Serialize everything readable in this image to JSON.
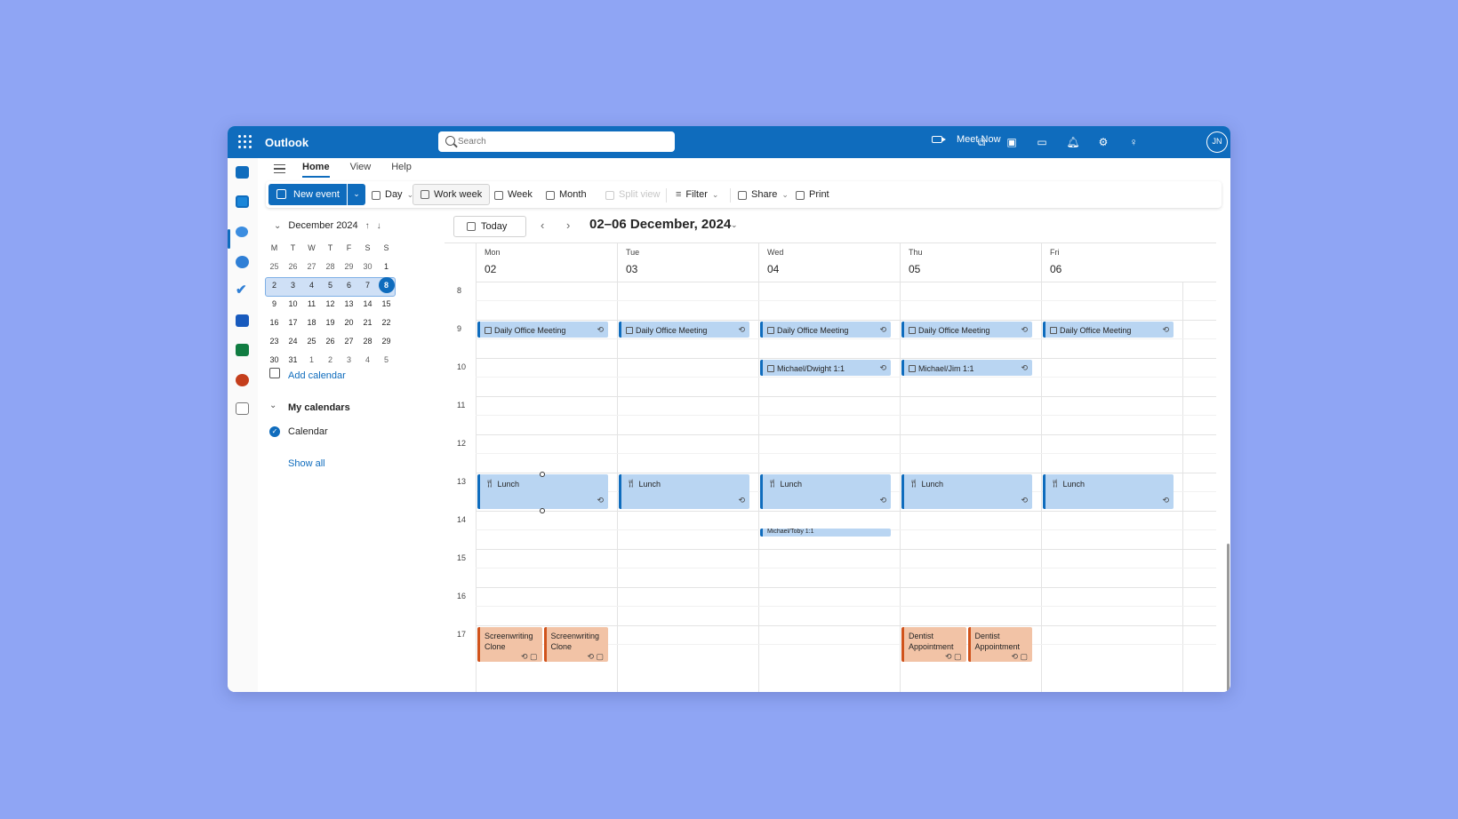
{
  "app": {
    "name": "Outlook"
  },
  "search": {
    "placeholder": "Search"
  },
  "topbar": {
    "meet_now": "Meet Now",
    "avatar": "JN"
  },
  "tabs": [
    "Home",
    "View",
    "Help"
  ],
  "ribbon": {
    "new_event": "New event",
    "day": "Day",
    "work_week": "Work week",
    "week": "Week",
    "month": "Month",
    "split_view": "Split view",
    "filter": "Filter",
    "share": "Share",
    "print": "Print"
  },
  "mini_calendar": {
    "title": "December 2024",
    "dow": [
      "M",
      "T",
      "W",
      "T",
      "F",
      "S",
      "S"
    ],
    "weeks": [
      [
        "25",
        "26",
        "27",
        "28",
        "29",
        "30",
        "1"
      ],
      [
        "2",
        "3",
        "4",
        "5",
        "6",
        "7",
        "8"
      ],
      [
        "9",
        "10",
        "11",
        "12",
        "13",
        "14",
        "15"
      ],
      [
        "16",
        "17",
        "18",
        "19",
        "20",
        "21",
        "22"
      ],
      [
        "23",
        "24",
        "25",
        "26",
        "27",
        "28",
        "29"
      ],
      [
        "30",
        "31",
        "1",
        "2",
        "3",
        "4",
        "5"
      ]
    ],
    "today": "8"
  },
  "sidebar": {
    "add_calendar": "Add calendar",
    "my_calendars": "My calendars",
    "calendar": "Calendar",
    "show_all": "Show all"
  },
  "calendar": {
    "today_button": "Today",
    "range": "02–06 December, 2024",
    "days": [
      {
        "name": "Mon",
        "date": "02"
      },
      {
        "name": "Tue",
        "date": "03"
      },
      {
        "name": "Wed",
        "date": "04"
      },
      {
        "name": "Thu",
        "date": "05"
      },
      {
        "name": "Fri",
        "date": "06"
      }
    ],
    "hours": [
      "8",
      "9",
      "10",
      "11",
      "12",
      "13",
      "14",
      "15",
      "16",
      "17"
    ],
    "events": {
      "daily": "Daily Office Meeting",
      "lunch": "Lunch",
      "michael_dwight": "Michael/Dwight 1:1",
      "michael_jim": "Michael/Jim 1:1",
      "michael_toby": "Michael/Toby 1:1",
      "screenwriting": "Screenwriting Clone",
      "dentist": "Dentist Appointment"
    }
  },
  "colors": {
    "brand": "#0f6cbd",
    "event_blue": "#b9d5f2",
    "event_orange": "#f2c3a6",
    "background": "#8fa5f4"
  }
}
